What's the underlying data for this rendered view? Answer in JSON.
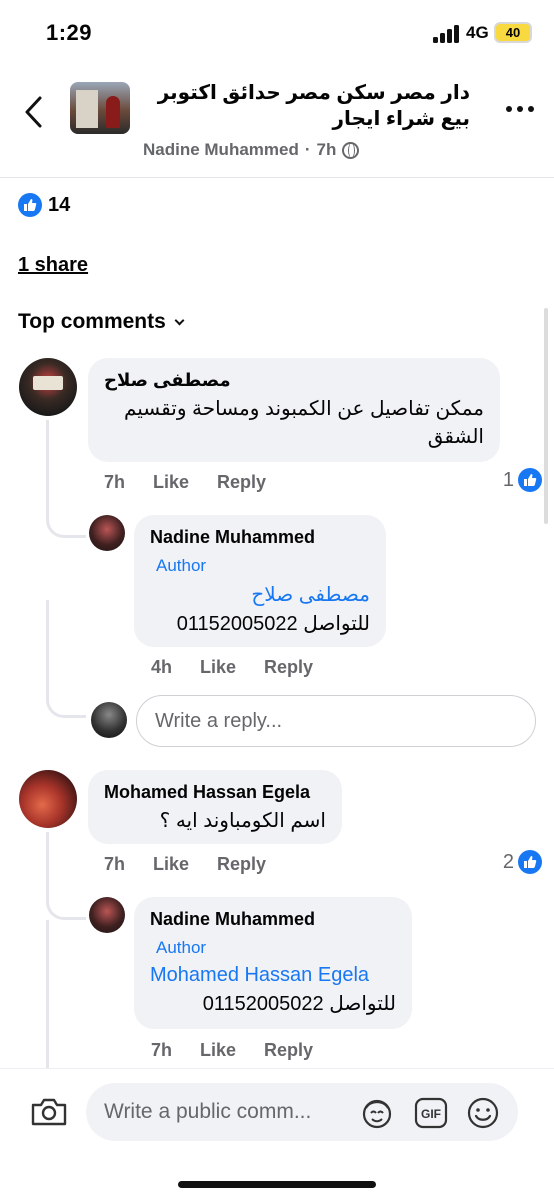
{
  "status_bar": {
    "time": "1:29",
    "network": "4G",
    "battery": "40"
  },
  "header": {
    "title": "دار مصر سكن مصر حدائق اكتوبر بيع شراء ايجار",
    "author": "Nadine Muhammed",
    "time": "7h",
    "separator": "·"
  },
  "reactions": {
    "count": "14"
  },
  "shares": {
    "label": "1 share"
  },
  "filter": {
    "label": "Top comments"
  },
  "comments": [
    {
      "author": "مصطفى صلاح",
      "text": "ممكن تفاصيل عن الكمبوند ومساحة وتقسيم الشقق",
      "time": "7h",
      "like": "Like",
      "reply": "Reply",
      "reactions": "1",
      "replies": [
        {
          "author": "Nadine Muhammed",
          "badge": "Author",
          "mention": "مصطفى صلاح",
          "text": "للتواصل 01152005022",
          "time": "4h",
          "like": "Like",
          "reply": "Reply"
        }
      ],
      "reply_placeholder": "Write a reply..."
    },
    {
      "author": "Mohamed Hassan Egela",
      "text": "اسم الكومباوند ايه ؟",
      "time": "7h",
      "like": "Like",
      "reply": "Reply",
      "reactions": "2",
      "replies": [
        {
          "author": "Nadine Muhammed",
          "badge": "Author",
          "mention": "Mohamed Hassan Egela",
          "text": "للتواصل 01152005022",
          "time": "7h",
          "like": "Like",
          "reply": "Reply"
        }
      ]
    }
  ],
  "composer": {
    "placeholder": "Write a public comm..."
  },
  "colors": {
    "accent": "#1877f2",
    "bubble": "#f0f2f5",
    "muted": "#65676b"
  }
}
